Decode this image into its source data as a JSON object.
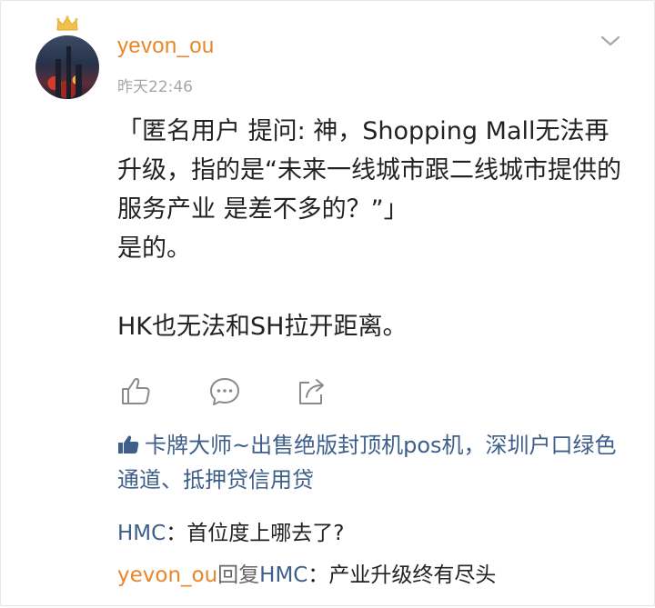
{
  "post": {
    "username": "yevon_ou",
    "timestamp": "昨天22:46",
    "content_lines": [
      "「匿名用户 提问: 神，Shopping Mall无法再升级，指的是“未来一线城市跟二线城市提供的 服务产业 是差不多的？”」",
      "是的。",
      "HK也无法和SH拉开距离。"
    ]
  },
  "likes": {
    "text": "卡牌大师~出售绝版封顶机pos机，深圳户口绿色通道、抵押贷信用贷"
  },
  "comments": [
    {
      "author": "HMC",
      "separator": "：",
      "text": "首位度上哪去了?"
    },
    {
      "author": "yevon_ou",
      "reply_word": "回复",
      "reply_to": "HMC",
      "separator": "：",
      "text": "产业升级终有尽头"
    }
  ],
  "icons": {
    "crown": "crown-icon",
    "chevron": "chevron-down-icon",
    "like": "thumbs-up-icon",
    "comment": "comment-bubble-icon",
    "share": "share-icon",
    "likes_marker": "thumbs-up-filled-icon"
  },
  "colors": {
    "username": "#e8862a",
    "timestamp": "#a6a6a6",
    "link": "#3d5f8a",
    "text": "#222222"
  }
}
